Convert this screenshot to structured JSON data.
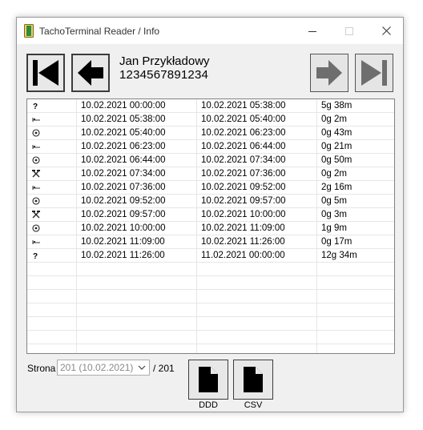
{
  "window": {
    "title": "TachoTerminal Reader / Info"
  },
  "driver": {
    "name": "Jan Przykładowy",
    "card": "1234567891234"
  },
  "nav": {
    "first_icon": "skip-first-icon",
    "prev_icon": "arrow-left-icon",
    "next_icon": "arrow-right-icon",
    "last_icon": "skip-last-icon",
    "next_enabled": false,
    "last_enabled": false
  },
  "activities": [
    {
      "icon": "unknown-icon",
      "start": "10.02.2021 00:00:00",
      "end": "10.02.2021 05:38:00",
      "duration": "5g 38m"
    },
    {
      "icon": "rest-bed-icon",
      "start": "10.02.2021 05:38:00",
      "end": "10.02.2021 05:40:00",
      "duration": "0g 2m"
    },
    {
      "icon": "driving-wheel-icon",
      "start": "10.02.2021 05:40:00",
      "end": "10.02.2021 06:23:00",
      "duration": "0g 43m"
    },
    {
      "icon": "rest-bed-icon",
      "start": "10.02.2021 06:23:00",
      "end": "10.02.2021 06:44:00",
      "duration": "0g 21m"
    },
    {
      "icon": "driving-wheel-icon",
      "start": "10.02.2021 06:44:00",
      "end": "10.02.2021 07:34:00",
      "duration": "0g 50m"
    },
    {
      "icon": "work-hammers-icon",
      "start": "10.02.2021 07:34:00",
      "end": "10.02.2021 07:36:00",
      "duration": "0g 2m"
    },
    {
      "icon": "rest-bed-icon",
      "start": "10.02.2021 07:36:00",
      "end": "10.02.2021 09:52:00",
      "duration": "2g 16m"
    },
    {
      "icon": "driving-wheel-icon",
      "start": "10.02.2021 09:52:00",
      "end": "10.02.2021 09:57:00",
      "duration": "0g 5m"
    },
    {
      "icon": "work-hammers-icon",
      "start": "10.02.2021 09:57:00",
      "end": "10.02.2021 10:00:00",
      "duration": "0g 3m"
    },
    {
      "icon": "driving-wheel-icon",
      "start": "10.02.2021 10:00:00",
      "end": "10.02.2021 11:09:00",
      "duration": "1g 9m"
    },
    {
      "icon": "rest-bed-icon",
      "start": "10.02.2021 11:09:00",
      "end": "10.02.2021 11:26:00",
      "duration": "0g 17m"
    },
    {
      "icon": "unknown-icon",
      "start": "10.02.2021 11:26:00",
      "end": "11.02.2021 00:00:00",
      "duration": "12g 34m"
    }
  ],
  "pager": {
    "label": "Strona",
    "selected": "201 (10.02.2021)",
    "total": "/ 201"
  },
  "export": {
    "ddd_label": "DDD",
    "csv_label": "CSV"
  }
}
